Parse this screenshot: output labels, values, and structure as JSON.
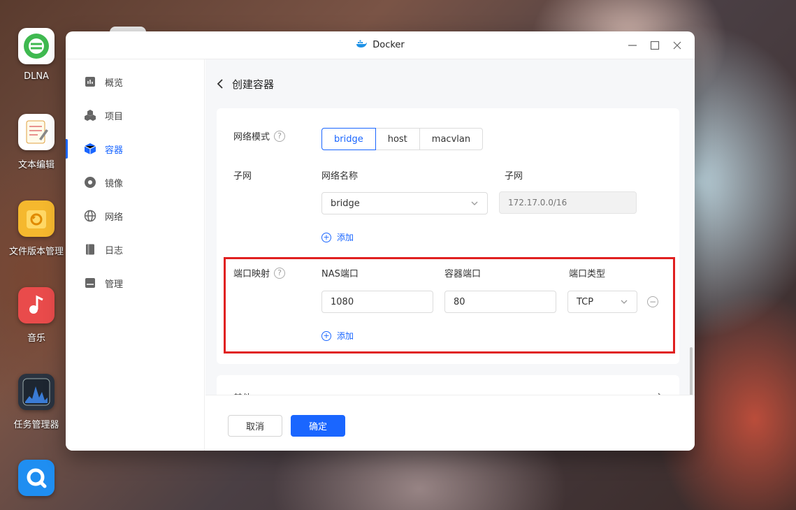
{
  "desktop": {
    "icons": [
      {
        "label": "DLNA",
        "icon": "dlna-icon",
        "color": "#3fb950"
      },
      {
        "label": "文本编辑",
        "icon": "text-editor-icon",
        "color": "#ffffff"
      },
      {
        "label": "文件版本管理",
        "icon": "file-version-icon",
        "color": "#f5b82e"
      },
      {
        "label": "音乐",
        "icon": "music-icon",
        "color": "#e94b4b"
      },
      {
        "label": "任务管理器",
        "icon": "task-manager-icon",
        "color": "#2a3340"
      },
      {
        "label": "",
        "icon": "search-app-icon",
        "color": "#1f8ef1"
      }
    ]
  },
  "window": {
    "title": "Docker",
    "title_icon": "docker-whale-icon"
  },
  "sidebar": {
    "items": [
      {
        "label": "概览",
        "icon": "overview-icon"
      },
      {
        "label": "项目",
        "icon": "project-icon"
      },
      {
        "label": "容器",
        "icon": "container-icon",
        "active": true
      },
      {
        "label": "镜像",
        "icon": "image-icon"
      },
      {
        "label": "网络",
        "icon": "network-icon"
      },
      {
        "label": "日志",
        "icon": "log-icon"
      },
      {
        "label": "管理",
        "icon": "manage-icon"
      }
    ]
  },
  "main": {
    "back_label": "创建容器",
    "network_mode": {
      "label": "网络模式",
      "options": [
        "bridge",
        "host",
        "macvlan"
      ],
      "selected": "bridge"
    },
    "subnet": {
      "label": "子网",
      "col_network_name": "网络名称",
      "col_subnet": "子网",
      "network_name_value": "bridge",
      "subnet_placeholder": "172.17.0.0/16",
      "add_label": "添加"
    },
    "port_mapping": {
      "label": "端口映射",
      "col_nas_port": "NAS端口",
      "col_container_port": "容器端口",
      "col_port_type": "端口类型",
      "nas_port_value": "1080",
      "container_port_value": "80",
      "port_type_value": "TCP",
      "add_label": "添加"
    },
    "other_section_label": "其他"
  },
  "footer": {
    "cancel_label": "取消",
    "ok_label": "确定"
  },
  "colors": {
    "accent": "#1a66ff",
    "highlight": "#e02020"
  }
}
